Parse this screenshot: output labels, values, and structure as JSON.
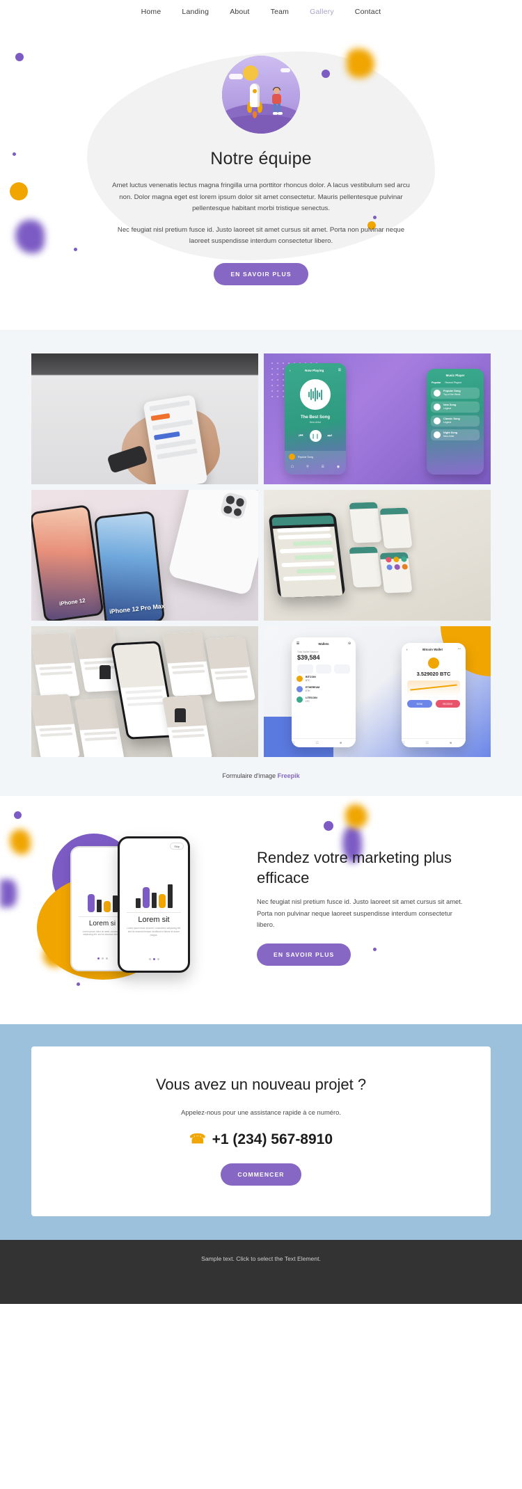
{
  "nav": {
    "items": [
      {
        "label": "Home",
        "active": false
      },
      {
        "label": "Landing",
        "active": false
      },
      {
        "label": "About",
        "active": false
      },
      {
        "label": "Team",
        "active": false
      },
      {
        "label": "Gallery",
        "active": true
      },
      {
        "label": "Contact",
        "active": false
      }
    ]
  },
  "hero": {
    "title": "Notre équipe",
    "paragraph1": "Amet luctus venenatis lectus magna fringilla urna porttitor rhoncus dolor. A lacus vestibulum sed arcu non. Dolor magna eget est lorem ipsum dolor sit amet consectetur. Mauris pellentesque pulvinar pellentesque habitant morbi tristique senectus.",
    "paragraph2": "Nec feugiat nisl pretium fusce id. Justo laoreet sit amet cursus sit amet. Porta non pulvinar neque laoreet suspendisse interdum consectetur libero.",
    "button": "EN SAVOIR PLUS",
    "illustration": "rocket-launch-icon"
  },
  "gallery": {
    "tiles": [
      {
        "name": "hand-holding-phone-photo",
        "alt": "Person holding smartphone over desk"
      },
      {
        "name": "music-player-app-mockup",
        "alt": "Music player app screens"
      },
      {
        "name": "phones-on-pink-surface-photo",
        "alt": "iPhone 12 Pro Max mockups"
      },
      {
        "name": "chat-app-screens-mockup",
        "alt": "Messaging app screens"
      },
      {
        "name": "catalog-app-screens-mockup",
        "alt": "Furniture catalog app screens"
      },
      {
        "name": "wallet-app-mockup",
        "alt": "Crypto wallet app screens"
      }
    ],
    "music_player": {
      "header": "Now Playing",
      "title": "The Best Song",
      "artist": "New Artist",
      "list_row_title": "Popular Song",
      "list_row_sub": "New Artist",
      "second_header": "Music Player",
      "tab1": "Popular",
      "tab2": "Recent Played",
      "items": [
        {
          "title": "Popular Song",
          "sub": "Top of the Week"
        },
        {
          "title": "New Song",
          "sub": "Legend"
        },
        {
          "title": "Classic Song",
          "sub": "Legend"
        },
        {
          "title": "Night Song",
          "sub": "New Artist"
        }
      ]
    },
    "phone_labels": {
      "left": "iPhone 12",
      "right": "iPhone 12\nPro Max"
    },
    "wallet": {
      "title1": "Wallets",
      "balance_label": "Total Wallet Balance",
      "balance": "$39,584",
      "rows": [
        {
          "name": "BITCOIN",
          "sub": "BTC"
        },
        {
          "name": "ETHEREUM",
          "sub": "ETH"
        },
        {
          "name": "LITECOIN",
          "sub": "LTC"
        }
      ],
      "title2": "Bitcoin Wallet",
      "btc_amount": "3.529020 BTC",
      "btn1": "SEND",
      "btn2": "RECEIVE"
    },
    "credit_text": "Formulaire d'image ",
    "credit_link": "Freepik"
  },
  "marketing": {
    "title": "Rendez votre marketing plus efficace",
    "paragraph": "Nec feugiat nisl pretium fusce id. Justo laoreet sit amet cursus sit amet. Porta non pulvinar neque laoreet suspendisse interdum consectetur libero.",
    "button": "EN SAVOIR PLUS",
    "phone_back_caption": "Lorem si",
    "phone_front_caption": "Lorem sit",
    "phone_skip": "Skip"
  },
  "contact": {
    "title": "Vous avez un nouveau projet ?",
    "subtitle": "Appelez-nous pour une assistance rapide à ce numéro.",
    "phone": "+1 (234) 567-8910",
    "phone_icon": "phone-icon",
    "button": "COMMENCER"
  },
  "footer": {
    "text": "Sample text. Click to select the Text Element."
  },
  "colors": {
    "accent_purple": "#8667c4",
    "accent_yellow": "#f0a500",
    "contact_bg": "#9cc1dd",
    "footer_bg": "#333333",
    "gallery_bg": "#f2f6f9"
  }
}
